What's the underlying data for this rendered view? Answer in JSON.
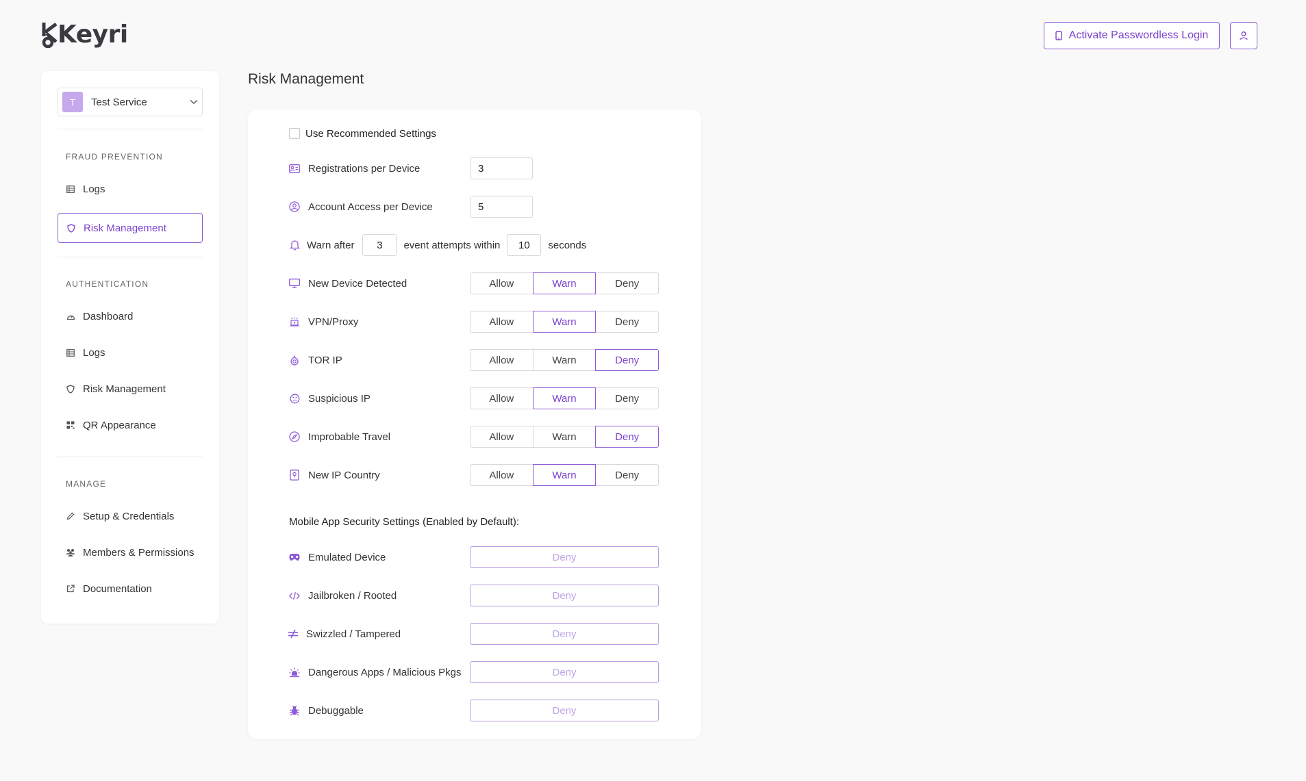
{
  "header": {
    "logo_text": "Keyri",
    "activate_label": "Activate Passwordless Login"
  },
  "sidebar": {
    "service": {
      "avatar": "T",
      "name": "Test Service"
    },
    "sections": [
      {
        "title": "FRAUD PREVENTION",
        "items": [
          {
            "label": "Logs",
            "icon": "table-icon"
          },
          {
            "label": "Risk Management",
            "icon": "shield-icon",
            "active": true
          }
        ]
      },
      {
        "title": "AUTHENTICATION",
        "items": [
          {
            "label": "Dashboard",
            "icon": "gauge-icon"
          },
          {
            "label": "Logs",
            "icon": "table-icon"
          },
          {
            "label": "Risk Management",
            "icon": "shield-icon"
          },
          {
            "label": "QR Appearance",
            "icon": "qr-icon"
          }
        ]
      },
      {
        "title": "MANAGE",
        "items": [
          {
            "label": "Setup & Credentials",
            "icon": "pencil-icon"
          },
          {
            "label": "Members & Permissions",
            "icon": "users-icon"
          },
          {
            "label": "Documentation",
            "icon": "external-link-icon"
          }
        ]
      }
    ]
  },
  "main": {
    "title": "Risk Management",
    "recommended_label": "Use Recommended Settings",
    "registrations": {
      "label": "Registrations per Device",
      "value": "3"
    },
    "account_access": {
      "label": "Account Access per Device",
      "value": "5"
    },
    "warn_rule": {
      "prefix": "Warn after",
      "attempts": "3",
      "middle": "event attempts within",
      "seconds": "10",
      "suffix": "seconds"
    },
    "options": [
      "Allow",
      "Warn",
      "Deny"
    ],
    "risk_rules": [
      {
        "label": "New Device Detected",
        "icon": "monitor-icon",
        "selected": "Warn"
      },
      {
        "label": "VPN/Proxy",
        "icon": "vpn-icon",
        "selected": "Warn"
      },
      {
        "label": "TOR IP",
        "icon": "tor-icon",
        "selected": "Deny"
      },
      {
        "label": "Suspicious IP",
        "icon": "alert-face-icon",
        "selected": "Warn"
      },
      {
        "label": "Improbable Travel",
        "icon": "compass-icon",
        "selected": "Deny"
      },
      {
        "label": "New IP Country",
        "icon": "map-pin-icon",
        "selected": "Warn"
      }
    ],
    "mobile_heading": "Mobile App Security Settings (Enabled by Default):",
    "mobile_rules": [
      {
        "label": "Emulated Device",
        "icon": "gamepad-icon",
        "value": "Deny"
      },
      {
        "label": "Jailbroken / Rooted",
        "icon": "code-icon",
        "value": "Deny"
      },
      {
        "label": "Swizzled / Tampered",
        "icon": "not-equal-icon",
        "value": "Deny"
      },
      {
        "label": "Dangerous Apps / Malicious Pkgs",
        "icon": "siren-icon",
        "value": "Deny"
      },
      {
        "label": "Debuggable",
        "icon": "bug-icon",
        "value": "Deny"
      }
    ]
  },
  "colors": {
    "accent": "#8e5bd6",
    "accent_text": "#7b43cf",
    "disabled_accent": "#bea5e6"
  }
}
